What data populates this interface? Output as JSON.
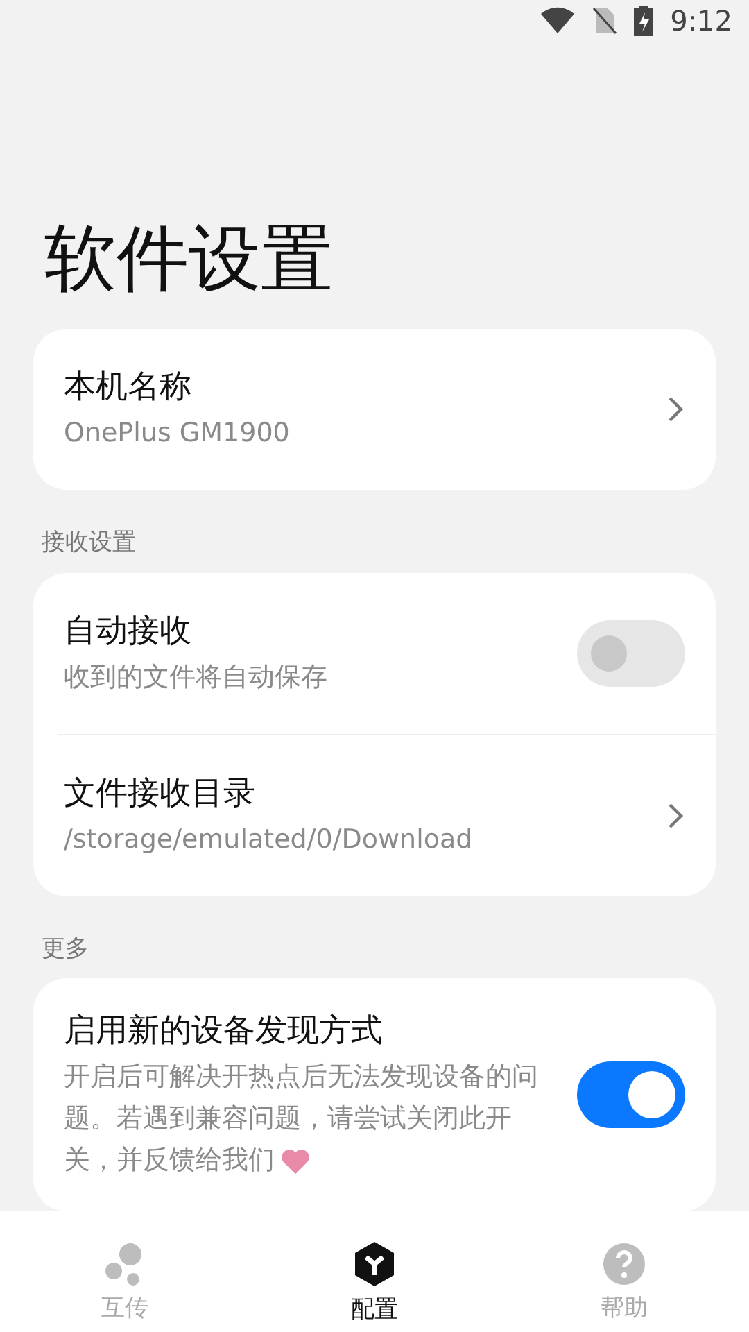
{
  "status_bar": {
    "time": "9:12"
  },
  "title": "软件设置",
  "sections": [
    {
      "items": [
        {
          "kind": "link",
          "title": "本机名称",
          "subtitle": "OnePlus GM1900"
        }
      ]
    },
    {
      "header": "接收设置",
      "items": [
        {
          "kind": "toggle",
          "title": "自动接收",
          "subtitle": "收到的文件将自动保存",
          "on": false
        },
        {
          "kind": "link",
          "title": "文件接收目录",
          "subtitle": "/storage/emulated/0/Download"
        }
      ]
    },
    {
      "header": "更多",
      "items": [
        {
          "kind": "toggle",
          "title": "启用新的设备发现方式",
          "subtitle": "开启后可解决开热点后无法发现设备的问题。若遇到兼容问题，请尝试关闭此开关，并反馈给我们",
          "heart": true,
          "on": true
        }
      ]
    }
  ],
  "nav": [
    {
      "kind": "transfer",
      "label": "互传",
      "selected": false
    },
    {
      "kind": "config",
      "label": "配置",
      "selected": true
    },
    {
      "kind": "help",
      "label": "帮助",
      "selected": false
    }
  ]
}
